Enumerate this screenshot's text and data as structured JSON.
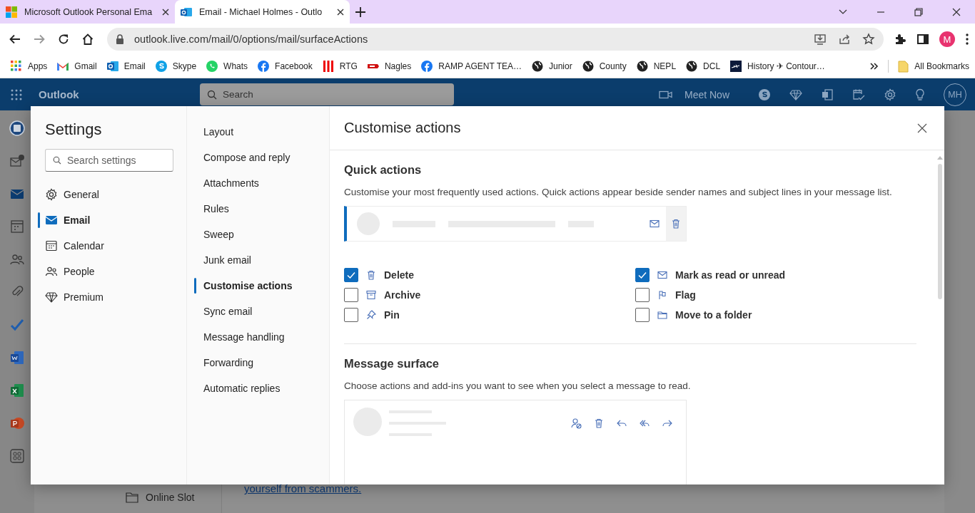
{
  "browser": {
    "tabs": [
      {
        "title": "Microsoft Outlook Personal Ema",
        "selected": false
      },
      {
        "title": "Email - Michael Holmes - Outlo",
        "selected": true
      }
    ],
    "url": "outlook.live.com/mail/0/options/mail/surfaceActions",
    "profile": "M",
    "bookmarks": [
      {
        "label": "Apps"
      },
      {
        "label": "Gmail"
      },
      {
        "label": "Email"
      },
      {
        "label": "Skype"
      },
      {
        "label": "Whats"
      },
      {
        "label": "Facebook"
      },
      {
        "label": "RTG"
      },
      {
        "label": "Nagles"
      },
      {
        "label": "RAMP AGENT TEA…"
      },
      {
        "label": "Junior"
      },
      {
        "label": "County"
      },
      {
        "label": "NEPL"
      },
      {
        "label": "DCL"
      },
      {
        "label": "History ✈ Contour…"
      }
    ],
    "all_bookmarks": "All Bookmarks"
  },
  "outlook": {
    "app_name": "Outlook",
    "search_placeholder": "Search",
    "meet_now": "Meet Now",
    "avatar": "MH",
    "folder": "Online Slot",
    "reading_text": "yourself from scammers."
  },
  "settings": {
    "title": "Settings",
    "search_placeholder": "Search settings",
    "categories": [
      {
        "label": "General",
        "selected": false
      },
      {
        "label": "Email",
        "selected": true
      },
      {
        "label": "Calendar",
        "selected": false
      },
      {
        "label": "People",
        "selected": false
      },
      {
        "label": "Premium",
        "selected": false
      }
    ],
    "subnav": [
      {
        "label": "Layout",
        "selected": false
      },
      {
        "label": "Compose and reply",
        "selected": false
      },
      {
        "label": "Attachments",
        "selected": false
      },
      {
        "label": "Rules",
        "selected": false
      },
      {
        "label": "Sweep",
        "selected": false
      },
      {
        "label": "Junk email",
        "selected": false
      },
      {
        "label": "Customise actions",
        "selected": true
      },
      {
        "label": "Sync email",
        "selected": false
      },
      {
        "label": "Message handling",
        "selected": false
      },
      {
        "label": "Forwarding",
        "selected": false
      },
      {
        "label": "Automatic replies",
        "selected": false
      }
    ],
    "panel": {
      "title": "Customise actions",
      "quick_actions": {
        "heading": "Quick actions",
        "description": "Customise your most frequently used actions. Quick actions appear beside sender names and subject lines in your message list.",
        "options": [
          {
            "label": "Delete",
            "checked": true
          },
          {
            "label": "Archive",
            "checked": false
          },
          {
            "label": "Pin",
            "checked": false
          },
          {
            "label": "Mark as read or unread",
            "checked": true
          },
          {
            "label": "Flag",
            "checked": false
          },
          {
            "label": "Move to a folder",
            "checked": false
          }
        ]
      },
      "message_surface": {
        "heading": "Message surface",
        "description": "Choose actions and add-ins you want to see when you select a message to read."
      }
    }
  }
}
